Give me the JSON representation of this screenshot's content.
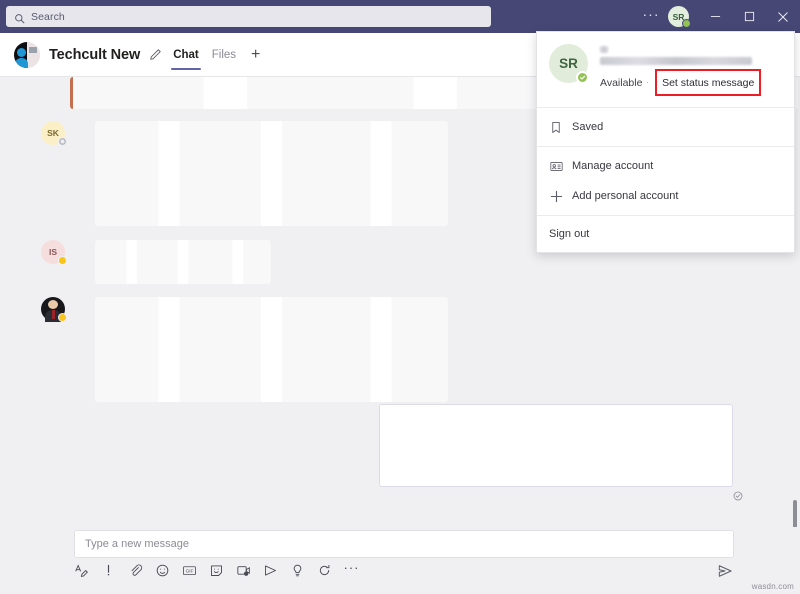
{
  "titlebar": {
    "search": {
      "placeholder": "Search",
      "icon": "search-icon"
    },
    "more_label": "···",
    "avatar_initials": "SR",
    "status_color": "#92c353",
    "minimize_label": "Minimize",
    "maximize_label": "Maximize",
    "close_label": "Close",
    "background": "#464775"
  },
  "chat_header": {
    "title": "Techcult New",
    "edit_icon": "pencil-icon",
    "tabs": [
      {
        "label": "Chat",
        "active": true
      },
      {
        "label": "Files",
        "active": false
      }
    ],
    "add_tab_label": "+",
    "accent": "#6264a7"
  },
  "messages": [
    {
      "sender_initials": "",
      "type": "incoming-urgent",
      "redacted": true,
      "urgent_color": "#c4704f"
    },
    {
      "sender_initials": "SK",
      "avatar_bg": "#fbefc8",
      "avatar_fg": "#7a6a2e",
      "status": "away-gray",
      "status_color": "#b5b5bd",
      "type": "incoming",
      "redacted": true
    },
    {
      "sender_initials": "IS",
      "avatar_bg": "#f6dede",
      "avatar_fg": "#8a5555",
      "status": "away",
      "status_color": "#f8c51c",
      "type": "incoming",
      "redacted": true
    },
    {
      "sender_initials": "",
      "avatar_bg": "#17171c",
      "avatar_fg": "#ffffff",
      "status": "away",
      "status_color": "#f8c51c",
      "type": "incoming-photo",
      "redacted": true
    },
    {
      "sender_initials": "",
      "type": "outgoing",
      "redacted": true,
      "seen_icon": "seen-check-icon"
    }
  ],
  "compose": {
    "placeholder": "Type a new message",
    "value": "",
    "tools": [
      {
        "name": "format-icon",
        "label": "Format"
      },
      {
        "name": "important-icon",
        "label": "Set delivery options"
      },
      {
        "name": "attach-icon",
        "label": "Attach"
      },
      {
        "name": "emoji-icon",
        "label": "Emoji"
      },
      {
        "name": "giphy-icon",
        "label": "Giphy"
      },
      {
        "name": "sticker-icon",
        "label": "Sticker"
      },
      {
        "name": "meet-now-icon",
        "label": "Meet now"
      },
      {
        "name": "stream-icon",
        "label": "Stream"
      },
      {
        "name": "praise-icon",
        "label": "Praise"
      },
      {
        "name": "loop-icon",
        "label": "Schedule"
      },
      {
        "name": "more-options-icon",
        "label": "···"
      }
    ],
    "send_label": "Send"
  },
  "profile_menu": {
    "avatar_initials": "SR",
    "name_redacted": true,
    "email_redacted": true,
    "status": "Available",
    "status_separator": "·",
    "set_status_message": "Set status message",
    "highlight_color": "#ee1c24",
    "items": [
      {
        "label": "Saved",
        "icon": "bookmark-icon"
      },
      {
        "label": "Manage account",
        "icon": "account-card-icon"
      },
      {
        "label": "Add personal account",
        "icon": "plus-icon"
      },
      {
        "label": "Sign out",
        "icon": ""
      }
    ]
  },
  "watermark": "wasdn.com"
}
